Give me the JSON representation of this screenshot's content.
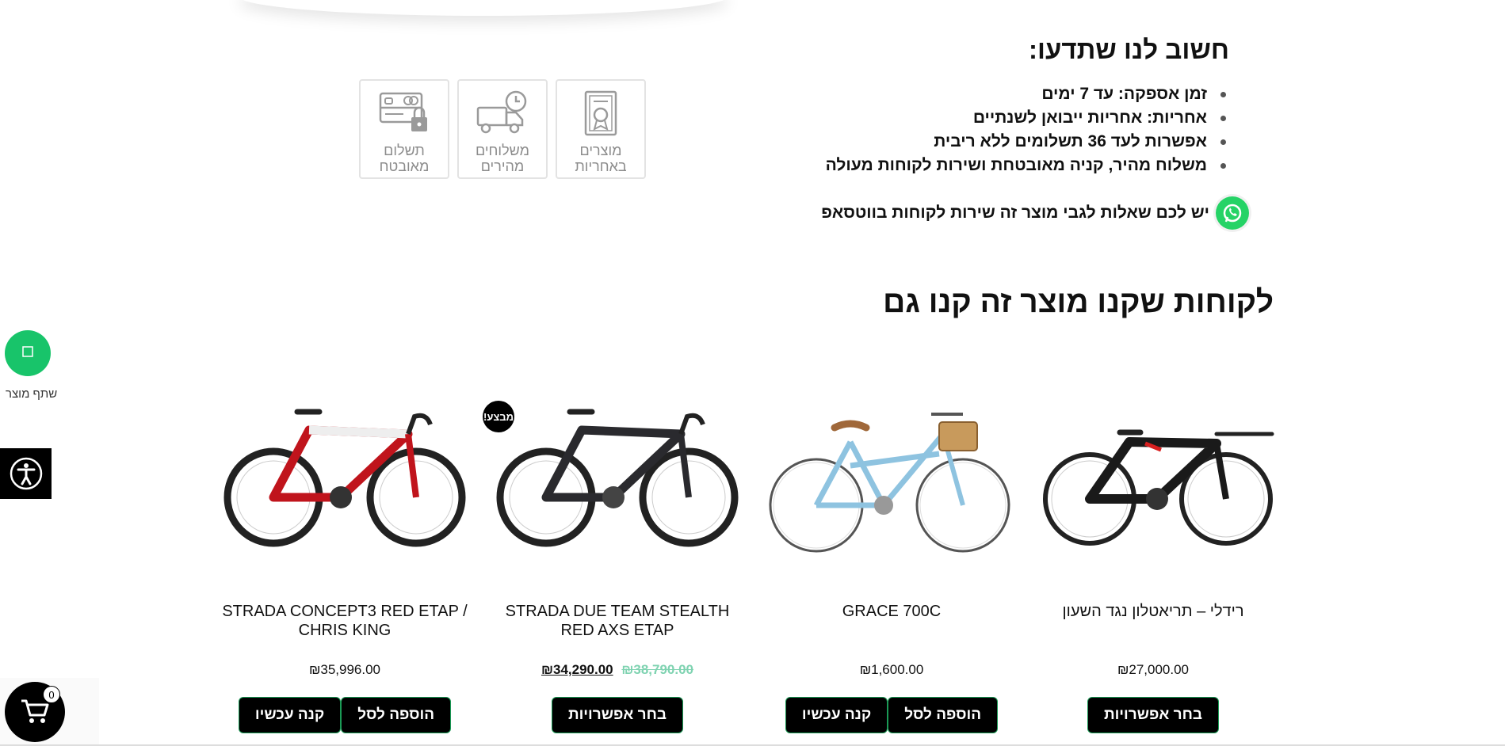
{
  "info": {
    "title": "חשוב לנו שתדעו:",
    "bullets": [
      "זמן אספקה: עד 7 ימים",
      "אחריות: אחריות ייבואן לשנתיים",
      "אפשרות לעד 36 תשלומים ללא ריבית",
      "משלוח מהיר, קניה מאובטחת ושירות לקוחות מעולה"
    ],
    "whatsapp_text": "יש לכם שאלות לגבי מוצר זה שירות לקוחות בווטסאפ"
  },
  "badges": [
    {
      "label": "מוצרים באחריות",
      "icon": "certificate-icon"
    },
    {
      "label": "משלוחים מהירים",
      "icon": "delivery-truck-icon"
    },
    {
      "label": "תשלום מאובטח",
      "icon": "secure-payment-icon"
    }
  ],
  "section_title": "לקוחות שקנו מוצר זה קנו גם",
  "share": {
    "label": "שתף מוצר"
  },
  "cart": {
    "count": "0"
  },
  "products": [
    {
      "title": "STRADA CONCEPT3 RED ETAP / CHRIS KING",
      "price": "₪35,996.00",
      "btn_buy": "קנה עכשיו",
      "btn_add": "הוספה לסל",
      "frame_color": "#c0141c"
    },
    {
      "title": "STRADA DUE TEAM STEALTH RED AXS ETAP",
      "price_new": "₪34,290.00",
      "price_old": "₪38,790.00",
      "badge": "מבצע!",
      "btn_options": "בחר אפשרויות",
      "frame_color": "#2a2a2e"
    },
    {
      "title": "GRACE 700C",
      "price": "₪1,600.00",
      "btn_buy": "קנה עכשיו",
      "btn_add": "הוספה לסל",
      "frame_color": "#8ec3e0"
    },
    {
      "title": "רידלי – תריאטלון נגד השעון",
      "price": "₪27,000.00",
      "btn_options": "בחר אפשרויות",
      "frame_color": "#1a1a1a"
    }
  ]
}
